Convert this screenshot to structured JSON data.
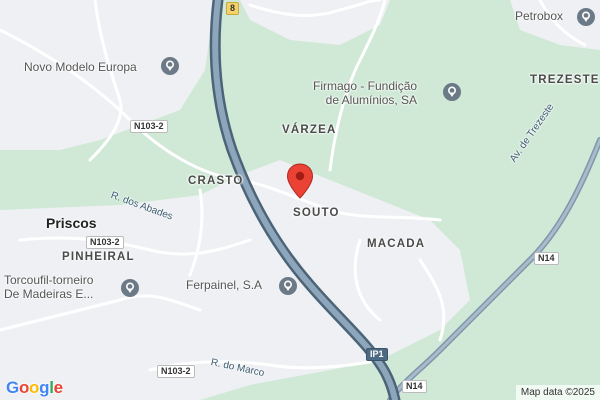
{
  "map": {
    "colors": {
      "land": "#cfe9d6",
      "built": "#eef0f3",
      "road_minor": "#ffffff",
      "highway": "#6f8aa0",
      "highway_fill": "#8ea6bb",
      "pin": "#ea4335",
      "poi": "#6b7a86"
    },
    "areas": {
      "varzea": "VÁRZEA",
      "crasto": "CRASTO",
      "souto": "SOUTO",
      "macada": "MACADA",
      "pinheiral": "PINHEIRAL",
      "trezeste": "TREZESTE"
    },
    "town": "Priscos",
    "pois": {
      "novo_modelo": "Novo Modelo Europa",
      "firmago": [
        "Firmago - Fundição",
        "de Alumínios, SA"
      ],
      "ferpainel": "Ferpainel, S.A",
      "torcoufil": [
        "Torcoufil-torneiro",
        "De Madeiras E..."
      ],
      "petrobox": "Petrobox"
    },
    "poi_icon": "map-pin-icon",
    "streets": {
      "abades": "R. dos Abades",
      "marco": "R. do Marco",
      "trezeste": "Av. de Trezeste"
    },
    "shields": {
      "n103_top": "N103-2",
      "n103_mid": "N103-2",
      "n103_bottom": "N103-2",
      "ip1": "IP1",
      "n14_right": "N14",
      "n14_bottom": "N14",
      "a8": "8"
    },
    "marker_icon": "red-location-marker",
    "logo": "Google",
    "attribution": "Map data ©2025"
  }
}
